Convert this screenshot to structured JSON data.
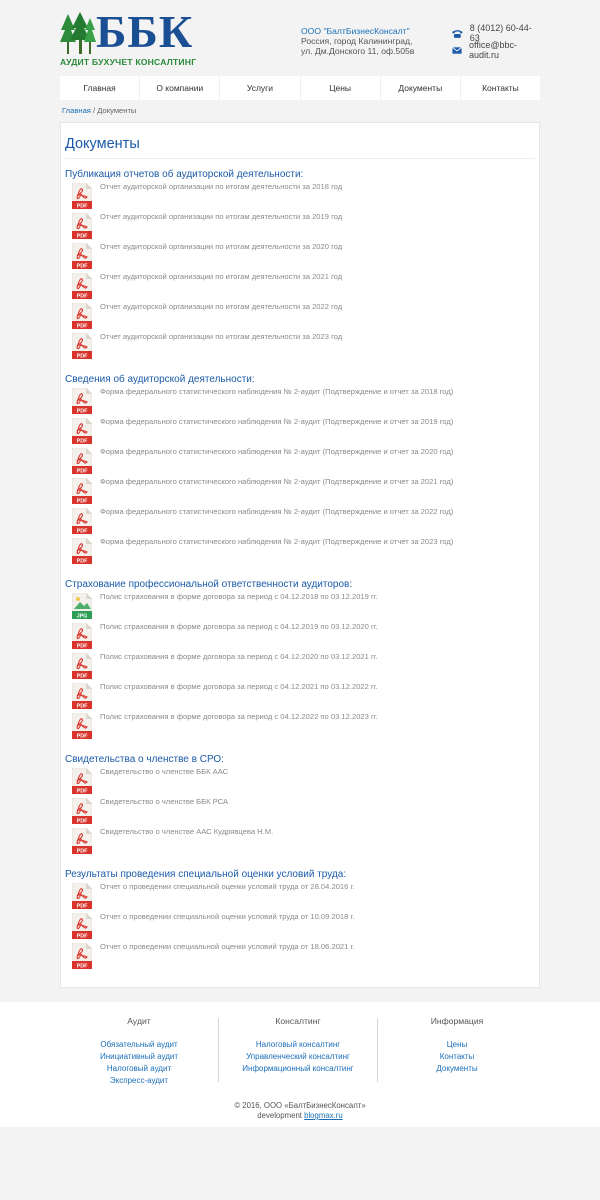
{
  "header": {
    "logo_text": "ББК",
    "tagline": "АУДИТ БУХУЧЕТ КОНСАЛТИНГ",
    "company_name": "ООО \"БалтБизнесКонсалт\"",
    "address_line1": "Россия, город Калининград,",
    "address_line2": "ул. Дм.Донского 11, оф.505в",
    "phone": "8 (4012) 60-44-63",
    "email": "office@bbc-audit.ru"
  },
  "nav": [
    "Главная",
    "О компании",
    "Услуги",
    "Цены",
    "Документы",
    "Контакты"
  ],
  "breadcrumb": {
    "home": "Главная",
    "sep": " / ",
    "current": "Документы"
  },
  "page_title": "Документы",
  "sections": [
    {
      "title": "Публикация отчетов об аудиторской деятельности:",
      "docs": [
        {
          "type": "pdf",
          "label": "Отчет аудиторской организации по итогам деятельности за 2018 год"
        },
        {
          "type": "pdf",
          "label": "Отчет аудиторской организации по итогам деятельности за 2019 год"
        },
        {
          "type": "pdf",
          "label": "Отчет аудиторской организации по итогам деятельности за 2020 год"
        },
        {
          "type": "pdf",
          "label": "Отчет аудиторской организации по итогам деятельности за 2021 год"
        },
        {
          "type": "pdf",
          "label": "Отчет аудиторской организации по итогам деятельности за 2022 год"
        },
        {
          "type": "pdf",
          "label": "Отчет аудиторской организации по итогам деятельности за 2023 год"
        }
      ]
    },
    {
      "title": "Сведения об аудиторской деятельности:",
      "docs": [
        {
          "type": "pdf",
          "label": "Форма федерального статистического наблюдения № 2-аудит (Подтверждение и отчет за 2018 год)"
        },
        {
          "type": "pdf",
          "label": "Форма федерального статистического наблюдения № 2-аудит (Подтверждение и отчет за 2019 год)"
        },
        {
          "type": "pdf",
          "label": "Форма федерального статистического наблюдения № 2-аудит (Подтверждение и отчет за 2020 год)"
        },
        {
          "type": "pdf",
          "label": "Форма федерального статистического наблюдения № 2-аудит (Подтверждение и отчет за 2021 год)"
        },
        {
          "type": "pdf",
          "label": "Форма федерального статистического наблюдения № 2-аудит (Подтверждение и отчет за 2022 год)"
        },
        {
          "type": "pdf",
          "label": "Форма федерального статистического наблюдения № 2-аудит (Подтверждение и отчет за 2023 год)"
        }
      ]
    },
    {
      "title": "Страхование профессиональной ответственности аудиторов:",
      "docs": [
        {
          "type": "jpg",
          "label": "Полис страхования в форме договора за период с 04.12.2018 по 03.12.2019 гг."
        },
        {
          "type": "pdf",
          "label": "Полис страхования в форме договора за период с 04.12.2019 по 03.12.2020 гг."
        },
        {
          "type": "pdf",
          "label": "Полис страхования в форме договора за период с 04.12.2020 по 03.12.2021 гг."
        },
        {
          "type": "pdf",
          "label": "Полис страхования в форме договора за период с 04.12.2021 по 03.12.2022 гг."
        },
        {
          "type": "pdf",
          "label": "Полис страхования в форме договора за период с 04.12.2022 по 03.12.2023 гг."
        }
      ]
    },
    {
      "title": "Свидетельства о членстве в СРО:",
      "docs": [
        {
          "type": "pdf",
          "label": "Свидетельство о членстве ББК ААС"
        },
        {
          "type": "pdf",
          "label": "Свидетельство о членстве ББК РСА"
        },
        {
          "type": "pdf",
          "label": "Свидетельство о членстве ААС Кудрявцева Н.М."
        }
      ]
    },
    {
      "title": "Результаты проведения специальной оценки условий труда:",
      "docs": [
        {
          "type": "pdf",
          "label": "Отчет о проведении специальной оценки условий труда от 28.04.2016 г."
        },
        {
          "type": "pdf",
          "label": "Отчет о проведении специальной оценки условий труда от 10.09.2018 г."
        },
        {
          "type": "pdf",
          "label": "Отчет о проведении специальной оценки условий труда от 18.06.2021 г."
        }
      ]
    }
  ],
  "footer": {
    "columns": [
      {
        "title": "Аудит",
        "links": [
          "Обязательный аудит",
          "Инициативный аудит",
          "Налоговый аудит",
          "Экспресс-аудит"
        ]
      },
      {
        "title": "Консалтинг",
        "links": [
          "Налоговый консалтинг",
          "Управленческий консалтинг",
          "Информационный консалтинг"
        ]
      },
      {
        "title": "Информация",
        "links": [
          "Цены",
          "Контакты",
          "Документы"
        ]
      }
    ],
    "copyright": "© 2016, ООО «БалтБизнесКонсалт»",
    "dev_prefix": "development ",
    "dev_link": "blogmax.ru"
  },
  "colors": {
    "brand_blue": "#1b4f93",
    "link_blue": "#1b6fb8",
    "pdf_red": "#d9342b",
    "jpg_green": "#2e9e57"
  }
}
